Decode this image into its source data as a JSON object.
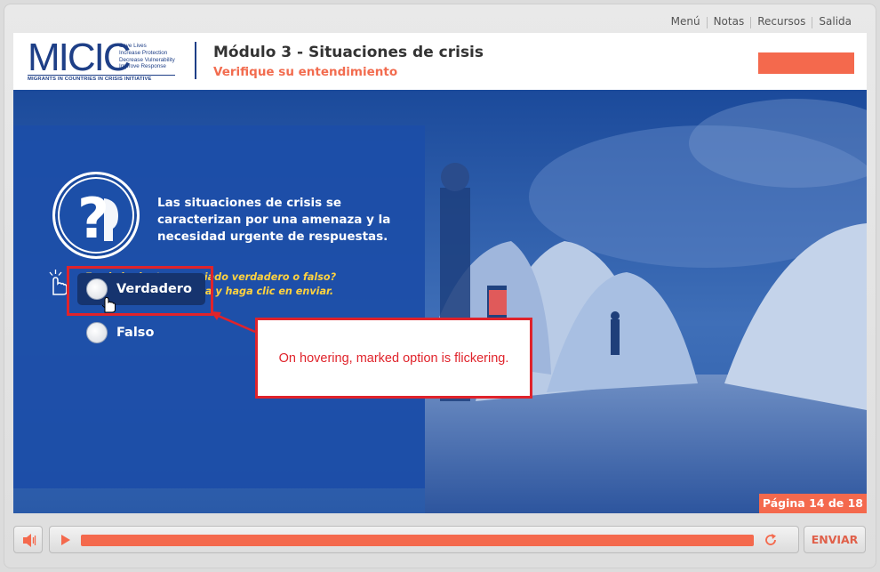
{
  "top_menu": {
    "menu": "Menú",
    "notes": "Notas",
    "resources": "Recursos",
    "exit": "Salida"
  },
  "logo": {
    "mark": "MICIC",
    "tagline": [
      "Save Lives",
      "Increase Protection",
      "Decrease Vulnerability",
      "Improve Response"
    ],
    "subtitle": "MIGRANTS IN COUNTRIES IN CRISIS INITIATIVE"
  },
  "header": {
    "title": "Módulo 3 - Situaciones de crisis",
    "subtitle": "Verifique su entendimiento"
  },
  "question": {
    "text": "Las situaciones de crisis se caracterizan por una amenaza y la necesidad urgente de respuestas.",
    "instruction": "¿Es el siguiente enunciado verdadero o falso? Seleccione la respuesta y haga clic en enviar.",
    "options": [
      {
        "label": "Verdadero",
        "hovered": true
      },
      {
        "label": "Falso",
        "hovered": false
      }
    ]
  },
  "annotation": {
    "text": "On hovering, marked option is flickering."
  },
  "page_indicator": "Página 14 de 18",
  "footer": {
    "submit_label": "ENVIAR",
    "progress": 0.98
  },
  "colors": {
    "accent": "#f4694d",
    "brand_blue": "#1e3f87",
    "annotation_red": "#e0232b",
    "instruction_yellow": "#ffd23f"
  },
  "icons": {
    "volume": "speaker-icon",
    "play": "play-icon",
    "replay": "replay-icon",
    "question": "question-head-icon",
    "hand": "pointing-hand-icon"
  }
}
